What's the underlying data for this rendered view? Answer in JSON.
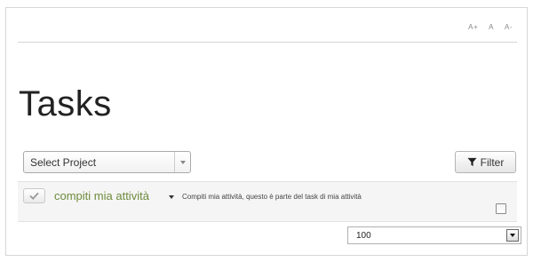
{
  "font_tools": {
    "increase": "A+",
    "normal": "A",
    "decrease": "A-"
  },
  "page": {
    "title": "Tasks"
  },
  "toolbar": {
    "project_select_value": "Select Project",
    "filter_label": "Filter"
  },
  "tasks": [
    {
      "title": "compiti mia attività",
      "description": "Compiti mia attività, questo è parte del task di mia attività"
    }
  ],
  "pagination": {
    "page_size": "100"
  },
  "colors": {
    "task_title": "#6e8b3d"
  }
}
